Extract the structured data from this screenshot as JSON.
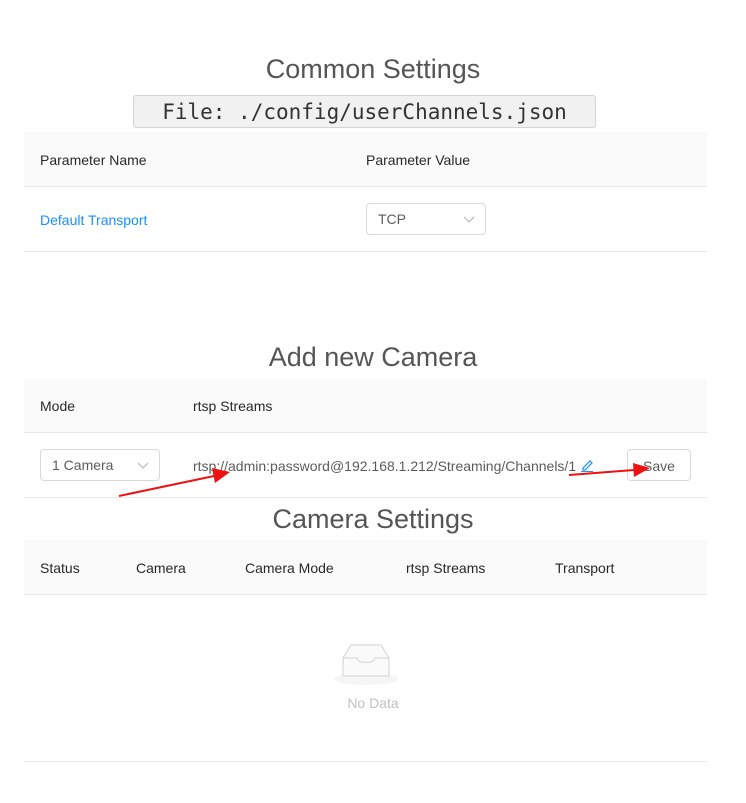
{
  "common": {
    "title": "Common Settings",
    "file_label": "File: ./config/userChannels.json",
    "col_name": "Parameter Name",
    "col_value": "Parameter Value",
    "rows": [
      {
        "name": "Default Transport",
        "value": "TCP"
      }
    ]
  },
  "add_camera": {
    "title": "Add new Camera",
    "col_mode": "Mode",
    "col_streams": "rtsp Streams",
    "mode_value": "1 Camera",
    "stream_value": "rtsp://admin:password@192.168.1.212/Streaming/Channels/1",
    "save_label": "Save"
  },
  "camera_settings": {
    "title": "Camera Settings",
    "columns": [
      "Status",
      "Camera",
      "Camera Mode",
      "rtsp Streams",
      "Transport"
    ],
    "empty_text": "No Data"
  },
  "colors": {
    "link": "#1890ff",
    "annotation_arrow": "#ee1111"
  }
}
